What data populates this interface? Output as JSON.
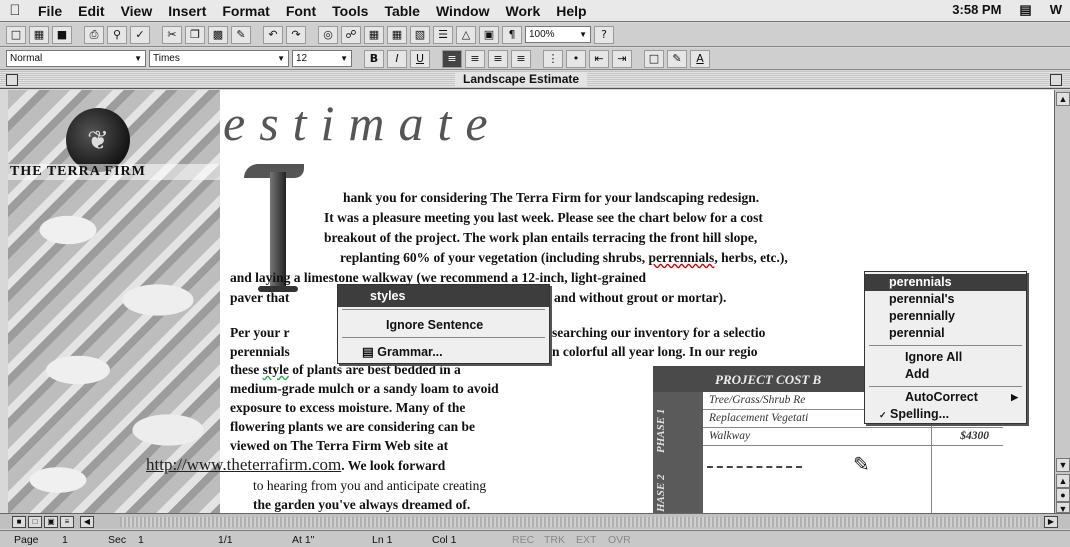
{
  "menubar": {
    "items": [
      "File",
      "Edit",
      "View",
      "Insert",
      "Format",
      "Font",
      "Tools",
      "Table",
      "Window",
      "Work",
      "Help"
    ],
    "clock": "3:58 PM"
  },
  "toolbar": {
    "zoom": "100%",
    "style": "Normal",
    "font": "Times",
    "size": "12"
  },
  "window": {
    "title": "Landscape Estimate"
  },
  "document": {
    "heading": "estimate",
    "brand": "THE TERRA FIRM",
    "para1": [
      "hank you for considering The Terra Firm for your landscaping redesign.",
      "It was a pleasure meeting you last week. Please see the chart below for a cost",
      "breakout of the project. The work plan entails terracing the front hill slope,"
    ],
    "para1_line4_a": "replanting 60% of your vegetation (including shrubs, ",
    "para1_line4_misspelled": "perrennials",
    "para1_line4_b": ", herbs, etc.),",
    "para1_line5": "and laying a limestone walkway (we recommend a 12-inch, light-grained",
    "para1_line6_a": "paver that",
    "para1_line6_b": "and without grout or mortar).",
    "para2_line1_a": "Per your r",
    "para2_line1_b": "searching our inventory for a selectio",
    "para2_line2_a": "perennials",
    "para2_line2_b": "n colorful all year long. In our regio",
    "para2_line3_a": "these ",
    "para2_line3_flag": "style",
    "para2_line3_b": " of plants are best bedded in a",
    "para2_more": [
      "medium-grade mulch or a sandy loam to avoid",
      "exposure to excess moisture. Many of the",
      "flowering plants we are considering can be",
      "viewed on The Terra Firm Web site at"
    ],
    "url": "http://www.theterrafirm.com",
    "url_after": ". We look forward",
    "closing": [
      "to hearing from you and anticipate creating",
      "the garden you've always dreamed of."
    ]
  },
  "cost_table": {
    "title": "PROJECT COST B",
    "phase1": "PHASE 1",
    "phase2": "HASE 2",
    "rows": [
      {
        "item": "Tree/Grass/Shrub Re",
        "cost": ""
      },
      {
        "item": "Replacement Vegetati",
        "cost": ""
      },
      {
        "item": "Walkway",
        "cost": "$4300"
      }
    ]
  },
  "grammar_menu": {
    "suggestion": "styles",
    "ignore": "Ignore Sentence",
    "grammar": "Grammar..."
  },
  "spelling_menu": {
    "suggestions": [
      "perennials",
      "perennial's",
      "perennially",
      "perennial"
    ],
    "ignore_all": "Ignore All",
    "add": "Add",
    "autocorrect": "AutoCorrect",
    "spelling": "Spelling..."
  },
  "status_bar": {
    "page": "Page",
    "page_num": "1",
    "sec": "Sec",
    "sec_num": "1",
    "pages": "1/1",
    "at": "At 1\"",
    "ln": "Ln 1",
    "col": "Col 1",
    "rec": "REC",
    "trk": "TRK",
    "ext": "EXT",
    "ovr": "OVR"
  },
  "colors": {
    "selection": "#3d3d3d",
    "misspelling": "#cc0000"
  }
}
